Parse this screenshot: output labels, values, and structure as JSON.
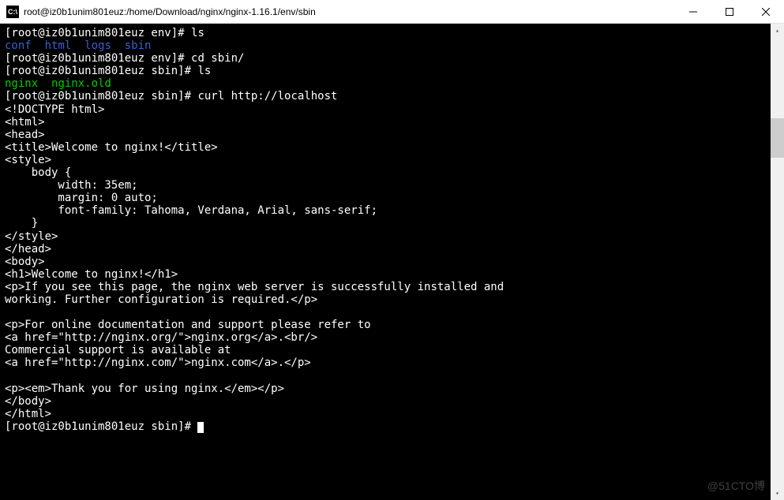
{
  "titlebar": {
    "icon_text": "C:\\",
    "title": "root@iz0b1unim801euz:/home/Download/nginx/nginx-1.16.1/env/sbin"
  },
  "terminal": {
    "lines": {
      "prompt1": "[root@iz0b1unim801euz env]# ",
      "cmd1": "ls",
      "ls_out_conf": "conf",
      "ls_out_html": "html",
      "ls_out_logs": "logs",
      "ls_out_sbin": "sbin",
      "prompt2": "[root@iz0b1unim801euz env]# ",
      "cmd2": "cd sbin/",
      "prompt3": "[root@iz0b1unim801euz sbin]# ",
      "cmd3": "ls",
      "ls2_nginx": "nginx",
      "ls2_nginxold": "nginx.old",
      "prompt4": "[root@iz0b1unim801euz sbin]# ",
      "cmd4": "curl http://localhost",
      "curl_body": "<!DOCTYPE html>\n<html>\n<head>\n<title>Welcome to nginx!</title>\n<style>\n    body {\n        width: 35em;\n        margin: 0 auto;\n        font-family: Tahoma, Verdana, Arial, sans-serif;\n    }\n</style>\n</head>\n<body>\n<h1>Welcome to nginx!</h1>\n<p>If you see this page, the nginx web server is successfully installed and\nworking. Further configuration is required.</p>\n\n<p>For online documentation and support please refer to\n<a href=\"http://nginx.org/\">nginx.org</a>.<br/>\nCommercial support is available at\n<a href=\"http://nginx.com/\">nginx.com</a>.</p>\n\n<p><em>Thank you for using nginx.</em></p>\n</body>\n</html>",
      "prompt5": "[root@iz0b1unim801euz sbin]# "
    }
  },
  "watermark": "@51CTO博"
}
